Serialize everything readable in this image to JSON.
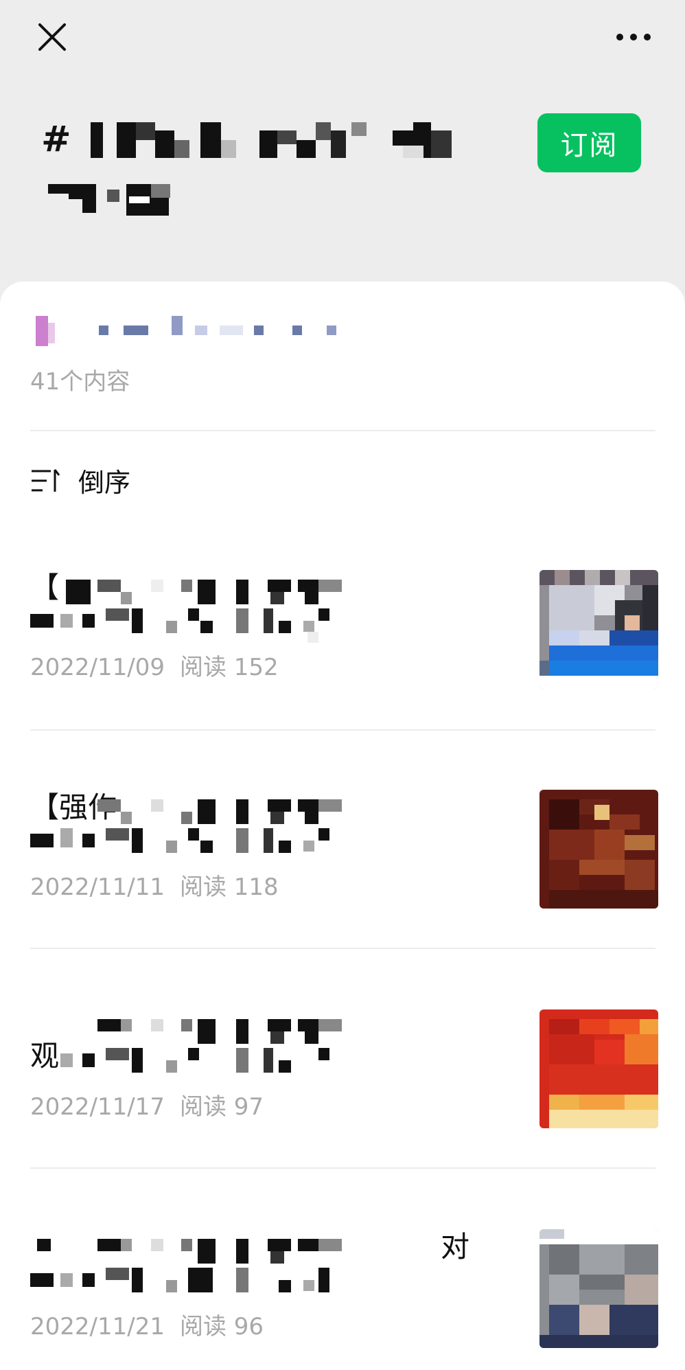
{
  "header": {
    "close_icon": "close-icon",
    "more_icon": "more-dots-icon",
    "hashtag_symbol": "#",
    "subscribe_label": "订阅",
    "accent_color": "#07c160"
  },
  "collection": {
    "content_count": "41个内容",
    "sort_label": "倒序",
    "sort_icon": "sort-order-icon"
  },
  "articles": [
    {
      "title_visible": "【",
      "date": "2022/11/09",
      "reads_label": "阅读",
      "reads": "152"
    },
    {
      "title_visible": "【强作",
      "date": "2022/11/11",
      "reads_label": "阅读",
      "reads": "118"
    },
    {
      "title_visible": "观",
      "date": "2022/11/17",
      "reads_label": "阅读",
      "reads": "97"
    },
    {
      "title_visible": "对",
      "date": "2022/11/21",
      "reads_label": "阅读",
      "reads": "96"
    }
  ]
}
